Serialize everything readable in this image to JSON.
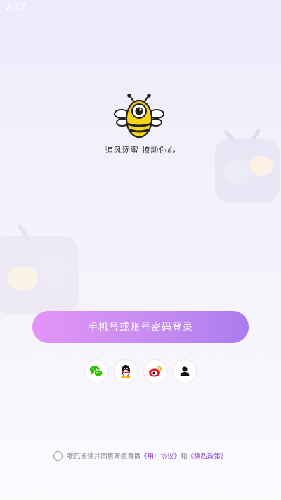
{
  "status_bar": {
    "time": "2:17"
  },
  "brand": {
    "tagline": "追风逐蜜  撩动你心"
  },
  "login": {
    "primary_label": "手机号或账号密码登录"
  },
  "social_login": {
    "items": [
      {
        "name": "wechat",
        "icon": "wechat-icon",
        "color": "#2dc100"
      },
      {
        "name": "qq",
        "icon": "qq-icon",
        "color": "#111111"
      },
      {
        "name": "weibo",
        "icon": "weibo-icon",
        "color": "#e6162d"
      },
      {
        "name": "guest",
        "icon": "user-icon",
        "color": "#111111"
      }
    ]
  },
  "agreement": {
    "prefix": "我已阅读并同意蜜疯直播",
    "user_agreement": "《用户协议》",
    "conjunction": "和",
    "privacy_policy": "《隐私政策》"
  },
  "colors": {
    "accent_start": "#e394f6",
    "accent_end": "#aa7cef",
    "link": "#8e3fd0",
    "bee_yellow": "#f7d417"
  }
}
